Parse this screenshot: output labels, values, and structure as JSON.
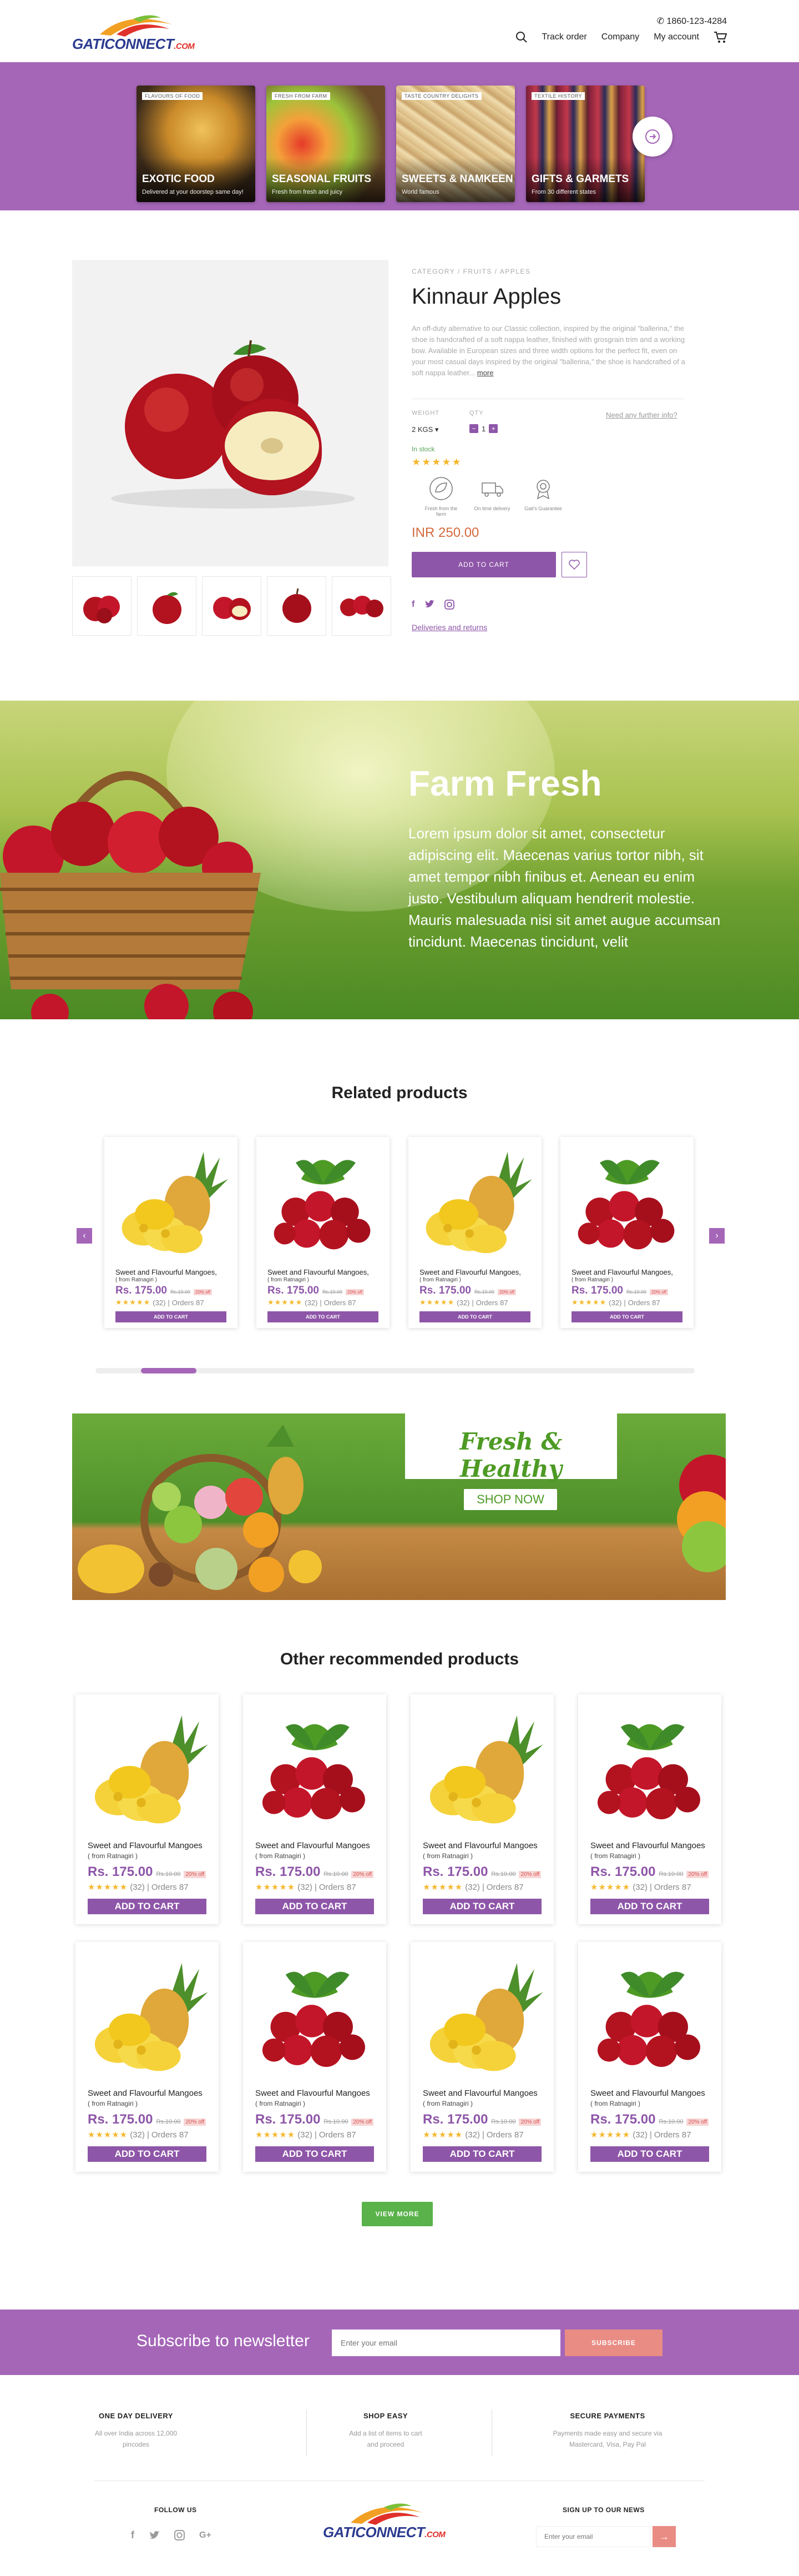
{
  "header": {
    "logo_text_1": "GATI",
    "logo_text_2": "CONNECT",
    "logo_text_3": ".COM",
    "phone": "1860-123-4284",
    "nav": {
      "track_order": "Track order",
      "company": "Company",
      "my_account": "My account"
    }
  },
  "categories": [
    {
      "tag": "FLAVOURS OF FOOD",
      "title": "EXOTIC FOOD",
      "subtitle": "Delivered at your doorstep same day!"
    },
    {
      "tag": "FRESH FROM FARM",
      "title": "SEASONAL FRUITS",
      "subtitle": "Fresh from fresh and juicy"
    },
    {
      "tag": "TASTE COUNTRY DELIGHTS",
      "title": "SWEETS & NAMKEEN",
      "subtitle": "World famous"
    },
    {
      "tag": "TEXTILE HISTORY",
      "title": "GIFTS & GARMETS",
      "subtitle": "From 30 different states"
    }
  ],
  "product": {
    "breadcrumb": "CATEGORY  /  FRUITS  /  APPLES",
    "title": "Kinnaur Apples",
    "description": "An off-duty alternative to our Classic collection, inspired by the original \"ballerina,\" the shoe is handcrafted of a soft nappa leather, finished with grosgrain trim and a working bow. Available in European sizes and three width options for the perfect fit, even on your most casual days inspired by the original \"ballerina,\" the shoe is handcrafted of a soft nappa leather...",
    "more": "more",
    "weight_label": "WEIGHT",
    "qty_label": "QTY",
    "weight_value": "2 KGS",
    "qty_value": "1",
    "need_info": "Need any further info?",
    "stock": "In stock",
    "features": [
      "Fresh from the farm",
      "On time delivery",
      "Gati's Guarantee"
    ],
    "price": "INR 250.00",
    "add_to_cart": "ADD TO CART",
    "delivery_link": "Deliveries and returns"
  },
  "farm": {
    "title": "Farm Fresh",
    "text": "Lorem ipsum dolor sit amet, consectetur adipiscing elit. Maecenas varius tortor nibh, sit amet tempor nibh finibus et. Aenean eu enim justo. Vestibulum aliquam hendrerit molestie. Mauris malesuada nisi sit amet augue accumsan tincidunt. Maecenas tincidunt, velit"
  },
  "related": {
    "title": "Related products",
    "card_name": "Sweet and Flavourful Mangoes,",
    "card_from": "( from Ratnagiri )",
    "price": "Rs. 175.00",
    "old_price": "Rs.10.00",
    "off": "20% off",
    "reviews": "(32)",
    "orders": "Orders 87",
    "cta": "ADD TO CART"
  },
  "fresh_banner": {
    "title": "Fresh & Healthy",
    "cta": "SHOP NOW"
  },
  "other": {
    "title": "Other recommended products",
    "card_name": "Sweet and Flavourful Mangoes",
    "card_from": "( from Ratnagiri )",
    "price": "Rs. 175.00",
    "old_price": "Rs.10.00",
    "off": "20% off",
    "reviews": "(32)",
    "orders": "Orders 87",
    "cta": "ADD TO CART"
  },
  "view_more": "VIEW MORE",
  "newsletter": {
    "label": "Subscribe to newsletter",
    "placeholder": "Enter your email",
    "cta": "SUBSCRIBE"
  },
  "footer": {
    "col1_title": "ONE DAY DELIVERY",
    "col1_text": "All over India across 12,000 pincodes",
    "col2_title": "SHOP EASY",
    "col2_text": "Add a list of items to cart and proceed",
    "col3_title": "SECURE PAYMENTS",
    "col3_text": "Payments made easy and secure via Mastercard, Visa, Pay Pal",
    "follow": "FOLLOW US",
    "signup": "SIGN UP TO OUR NEWS",
    "signup_placeholder": "Enter your email"
  },
  "colors": {
    "brand_purple": "#a566b8",
    "button_purple": "#8e56a8",
    "green": "#59b24a",
    "coral": "#e98c84"
  },
  "icons": [
    "search-icon",
    "cart-icon",
    "phone-icon",
    "arrow-right-icon",
    "heart-icon",
    "facebook-icon",
    "twitter-icon",
    "instagram-icon",
    "google-plus-icon"
  ]
}
